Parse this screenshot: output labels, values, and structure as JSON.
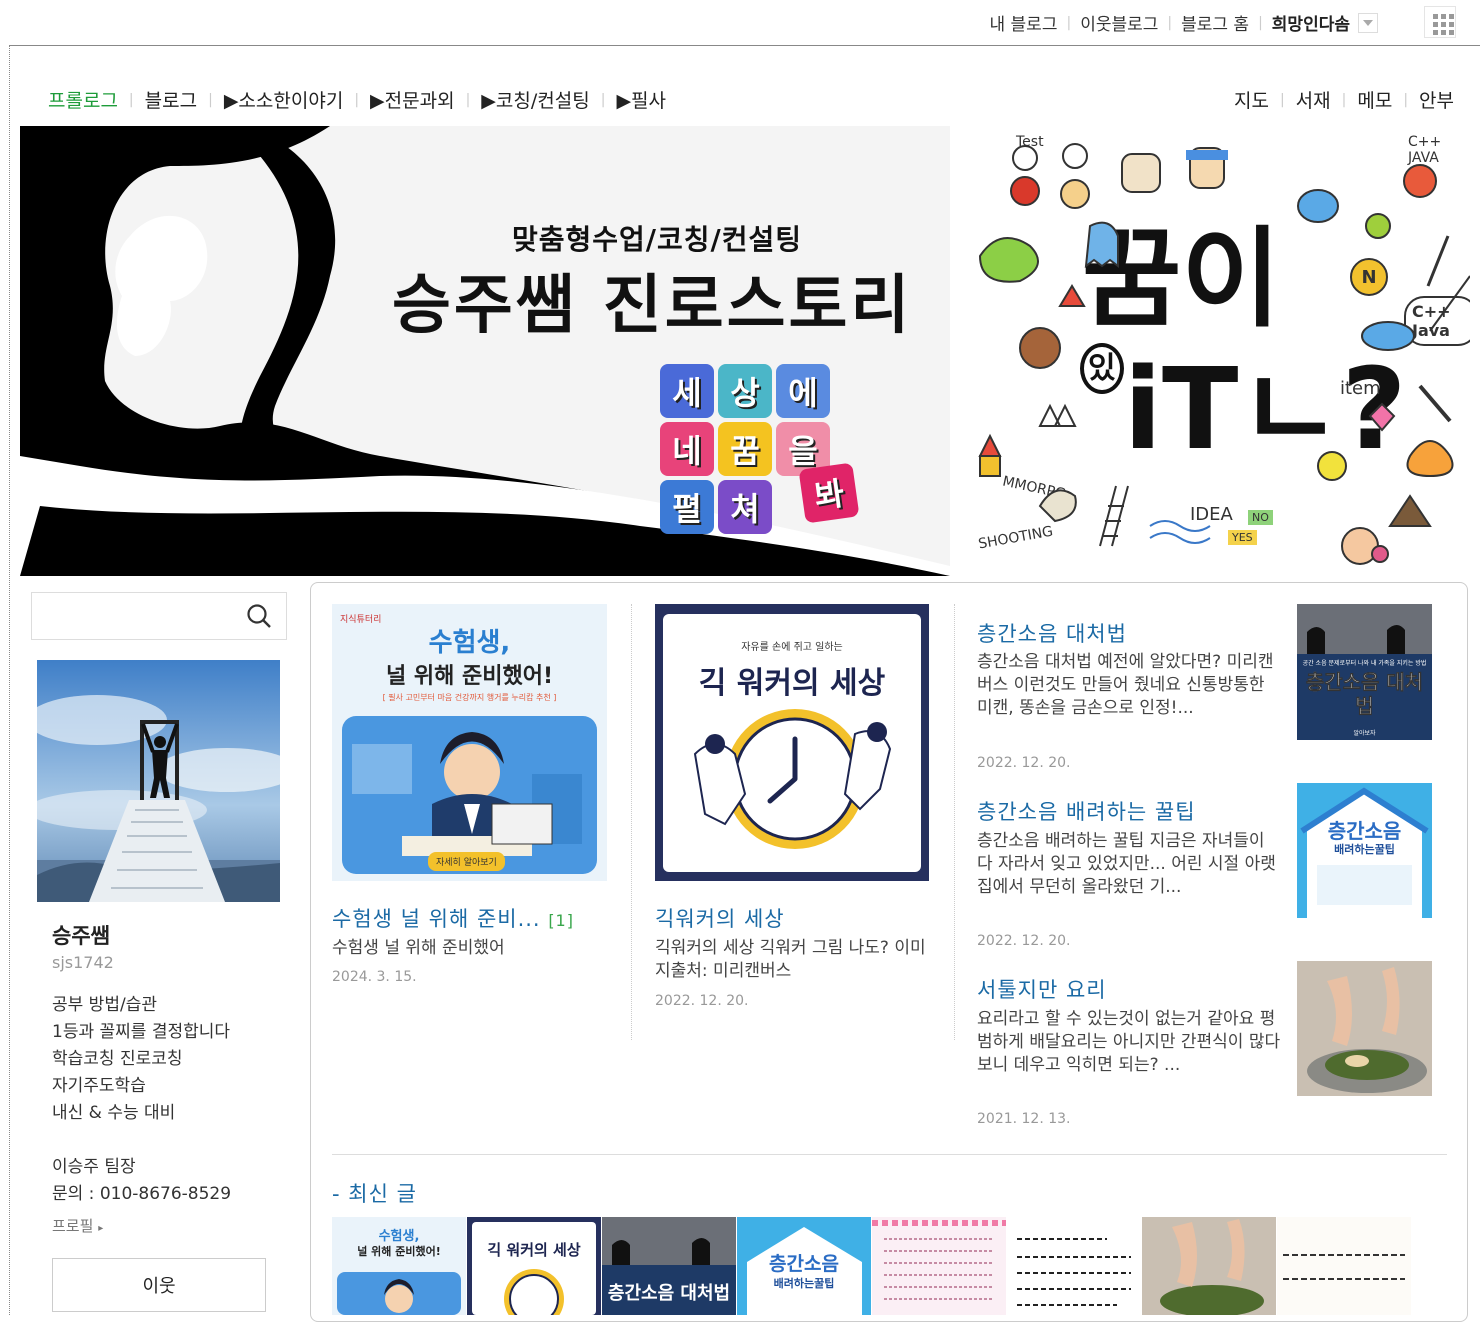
{
  "gnb": {
    "links": [
      "내 블로그",
      "이웃블로그",
      "블로그 홈"
    ],
    "user": "희망인다솜"
  },
  "menu": {
    "items": [
      "프롤로그",
      "블로그",
      "▶소소한이야기",
      "▶전문과외",
      "▶코칭/컨설팅",
      "▶필사"
    ],
    "right": [
      "지도",
      "서재",
      "메모",
      "안부"
    ]
  },
  "banner": {
    "subtitle": "맞춤형수업/코칭/컨설팅",
    "title": "승주쌤 진로스토리",
    "puzzle": [
      "세",
      "상",
      "에",
      "네",
      "꿈",
      "을",
      "펼",
      "쳐",
      "봐"
    ],
    "dream_top": "꿈이",
    "dream_small": "있",
    "dream_bottom": "iTㄴ?",
    "doodles": {
      "test": "Test",
      "c": "C++ JAVA",
      "item": "item",
      "mmorpg": "MMORPG",
      "shooting": "SHOOTING",
      "idea": "IDEA",
      "no": "NO",
      "yes": "YES",
      "n": "N",
      "cjava": "C++ Java"
    }
  },
  "sidebar": {
    "nickname": "승주쌤",
    "user_id": "sjs1742",
    "desc": [
      "공부 방법/습관",
      "1등과 꼴찌를 결정합니다",
      "학습코칭 진로코칭",
      "자기주도학습",
      "내신 & 수능 대비"
    ],
    "contact": [
      "이승주 팀장",
      "문의 : 010-8676-8529"
    ],
    "profile_link": "프로필",
    "neighbor_button": "이웃"
  },
  "posts": [
    {
      "title": "수험생 널 위해 준비...",
      "count": "[1]",
      "summary": "수험생 널 위해 준비했어",
      "date": "2024. 3. 15.",
      "thumb": {
        "line1": "수험생,",
        "line2": "널 위해 준비했어!",
        "tag": "[ 필사 고민부터 마음 건강까지 행거를 누리캅 추천 ]",
        "badge": "자세히 알아보기",
        "logo": "지식튜터리"
      }
    },
    {
      "title": "긱워커의 세상",
      "summary": "긱워커의 세상 긱워커 그림 나도? 이미지출처: 미리캔버스",
      "date": "2022. 12. 20.",
      "thumb": {
        "top": "자유를 손에 쥐고 일하는",
        "main": "긱 워커의 세상"
      }
    },
    {
      "title": "층간소음 대처법",
      "summary": "층간소음 대처법 예전에 알았다면? 미리캔버스 이런것도 만들어 줬네요 신통방통한 미캔, 똥손을 금손으로 인정!...",
      "date": "2022. 12. 20.",
      "thumb": {
        "small": "공간 소음 문제로부터 나와 내 가족을 지키는 방법",
        "main": "층간소음 대처법",
        "foot": "알아보자"
      }
    },
    {
      "title": "층간소음 배려하는 꿀팁",
      "summary": "층간소음 배려하는 꿀팁 지금은 자녀들이 다 자라서 잊고 있었지만... 어린 시절 아랫집에서 무던히 올라왔던 기...",
      "date": "2022. 12. 20.",
      "thumb": {
        "main": "층간소음",
        "sub": "배려하는꿀팁"
      }
    },
    {
      "title": "서툴지만 요리",
      "summary": "요리라고 할 수 있는것이 없는거 같아요 평범하게 배달요리는 아니지만 간편식이 많다보니 데우고 익히면 되는? ...",
      "date": "2021. 12. 13."
    }
  ],
  "recent": {
    "title": "- 최신 글"
  },
  "colors": {
    "accent_green": "#1e9c3a",
    "title_blue": "#1b6aa5"
  }
}
